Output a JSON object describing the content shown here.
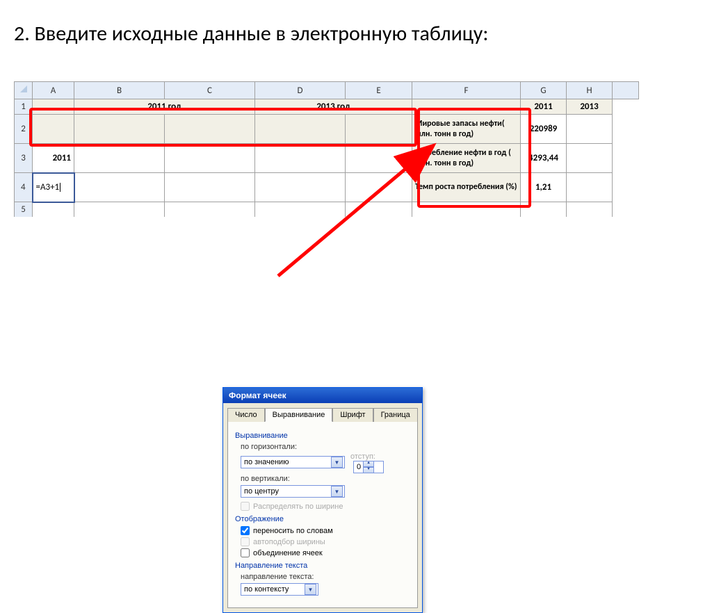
{
  "title": "2. Введите исходные данные в электронную таблицу:",
  "columns": [
    "A",
    "B",
    "C",
    "D",
    "E",
    "F",
    "G",
    "H",
    ""
  ],
  "rows": [
    "1",
    "2",
    "3",
    "4",
    "5"
  ],
  "grid": {
    "B1": "2011 год",
    "D1": "2013 год",
    "G1": "2011",
    "H1": "2013",
    "F2": "Мировые запасы нефти( млн. тонн в год)",
    "G2": "220989",
    "F3": "потребление нефти в год ( млн. тонн в год)",
    "G3": "4293,44",
    "F4": "Темп роста потребления (%)",
    "G4": "1,21",
    "A3": "2011",
    "A4": "=A3+1"
  },
  "dialog": {
    "title": "Формат ячеек",
    "tabs": [
      "Число",
      "Выравнивание",
      "Шрифт",
      "Граница"
    ],
    "sections": {
      "alignment": "Выравнивание",
      "horiz_label": "по горизонтали:",
      "horiz_value": "по значению",
      "indent_label": "отступ:",
      "indent_value": "0",
      "vert_label": "по вертикали:",
      "vert_value": "по центру",
      "distribute": "Распределять по ширине",
      "display": "Отображение",
      "wrap": "переносить по словам",
      "autowidth": "автоподбор ширины",
      "merge": "объединение ячеек",
      "direction": "Направление текста",
      "dir_label": "направление текста:",
      "dir_value": "по контексту"
    }
  }
}
